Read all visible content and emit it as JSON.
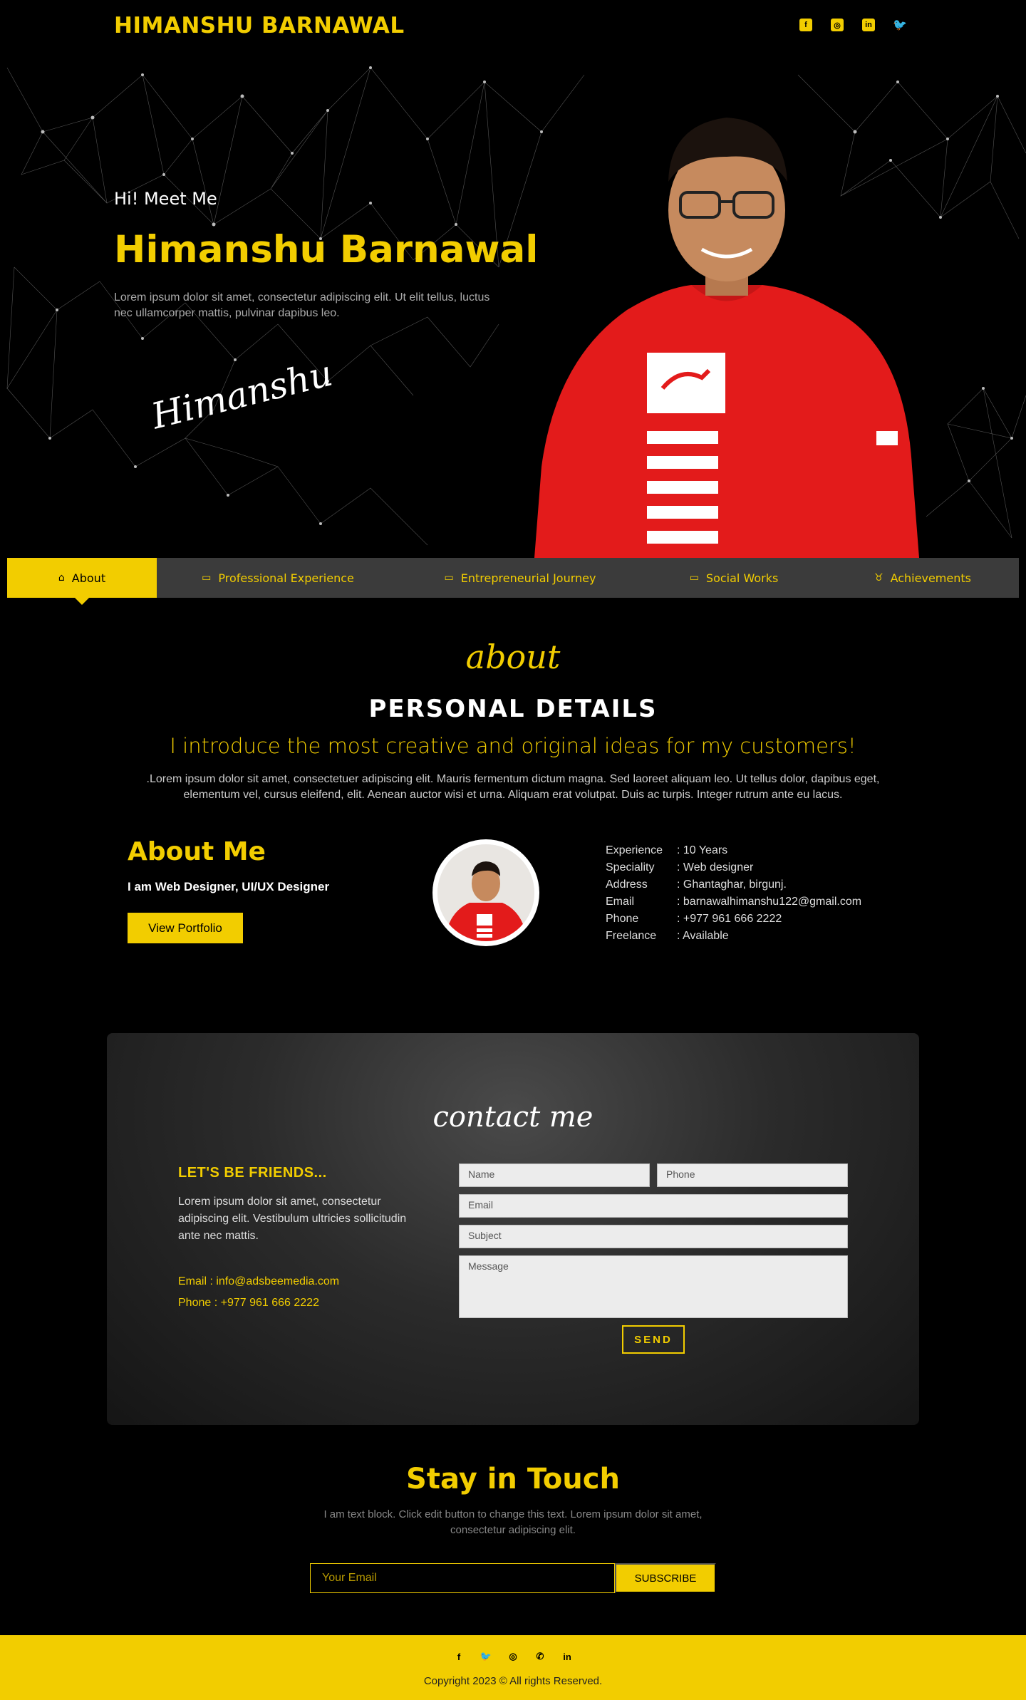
{
  "header": {
    "brand": "HIMANSHU BARNAWAL",
    "social_icons": [
      "facebook-square-icon",
      "instagram-icon",
      "linkedin-icon",
      "twitter-icon"
    ]
  },
  "hero": {
    "greeting": "Hi! Meet Me",
    "name": "Himanshu Barnawal",
    "description": "Lorem ipsum dolor sit amet, consectetur adipiscing elit. Ut elit tellus, luctus nec ullamcorper mattis, pulvinar dapibus leo.",
    "signature": "Himanshu"
  },
  "tabs": [
    {
      "label": "About",
      "icon": "home-icon",
      "active": true
    },
    {
      "label": "Professional Experience",
      "icon": "laptop-code-icon",
      "active": false
    },
    {
      "label": "Entrepreneurial Journey",
      "icon": "laptop-icon",
      "active": false
    },
    {
      "label": "Social Works",
      "icon": "laptop-code-icon",
      "active": false
    },
    {
      "label": "Achievements",
      "icon": "medal-icon",
      "active": false
    }
  ],
  "about": {
    "script_title": "about",
    "section_title": "PERSONAL DETAILS",
    "intro": "I introduce the most creative and original ideas for my customers!",
    "lorem": ".Lorem ipsum dolor sit amet, consectetuer adipiscing elit. Mauris fermentum dictum magna. Sed laoreet aliquam leo. Ut tellus dolor, dapibus eget, elementum vel, cursus eleifend, elit. Aenean auctor wisi et urna. Aliquam erat volutpat. Duis ac turpis. Integer rutrum ante eu lacus.",
    "heading": "About Me",
    "role": "I am Web Designer, UI/UX Designer",
    "portfolio_button": "View Portfolio",
    "details": [
      {
        "label": "Experience",
        "value": ": 10 Years"
      },
      {
        "label": "Speciality",
        "value": ": Web designer"
      },
      {
        "label": "Address",
        "value": ": Ghantaghar, birgunj."
      },
      {
        "label": "Email",
        "value": ": barnawalhimanshu122@gmail.com"
      },
      {
        "label": "Phone",
        "value": ": +977 961 666 2222"
      },
      {
        "label": "Freelance",
        "value": ": Available"
      }
    ]
  },
  "contact": {
    "script_title": "contact me",
    "friends_title": "LET'S BE FRIENDS...",
    "friends_desc": "Lorem ipsum dolor sit amet, consectetur adipiscing elit. Vestibulum ultricies sollicitudin ante nec mattis.",
    "email_line": "Email : info@adsbeemedia.com",
    "phone_line": "Phone : +977 961 666 2222",
    "form": {
      "name_placeholder": "Name",
      "phone_placeholder": "Phone",
      "email_placeholder": "Email",
      "subject_placeholder": "Subject",
      "message_placeholder": "Message",
      "send_label": "SEND"
    }
  },
  "stay": {
    "title": "Stay in Touch",
    "description": "I am text block. Click edit button to change this text. Lorem ipsum dolor sit amet, consectetur adipiscing elit.",
    "email_placeholder": "Your Email",
    "subscribe_label": "SUBSCRIBE"
  },
  "footer": {
    "icons": [
      "facebook-icon",
      "twitter-icon",
      "instagram-icon",
      "whatsapp-icon",
      "linkedin-icon"
    ],
    "copyright": "Copyright 2023 © All rights Reserved."
  },
  "colors": {
    "accent": "#f2cd00",
    "background": "#000000",
    "tab_bar": "#3b3b3b"
  }
}
